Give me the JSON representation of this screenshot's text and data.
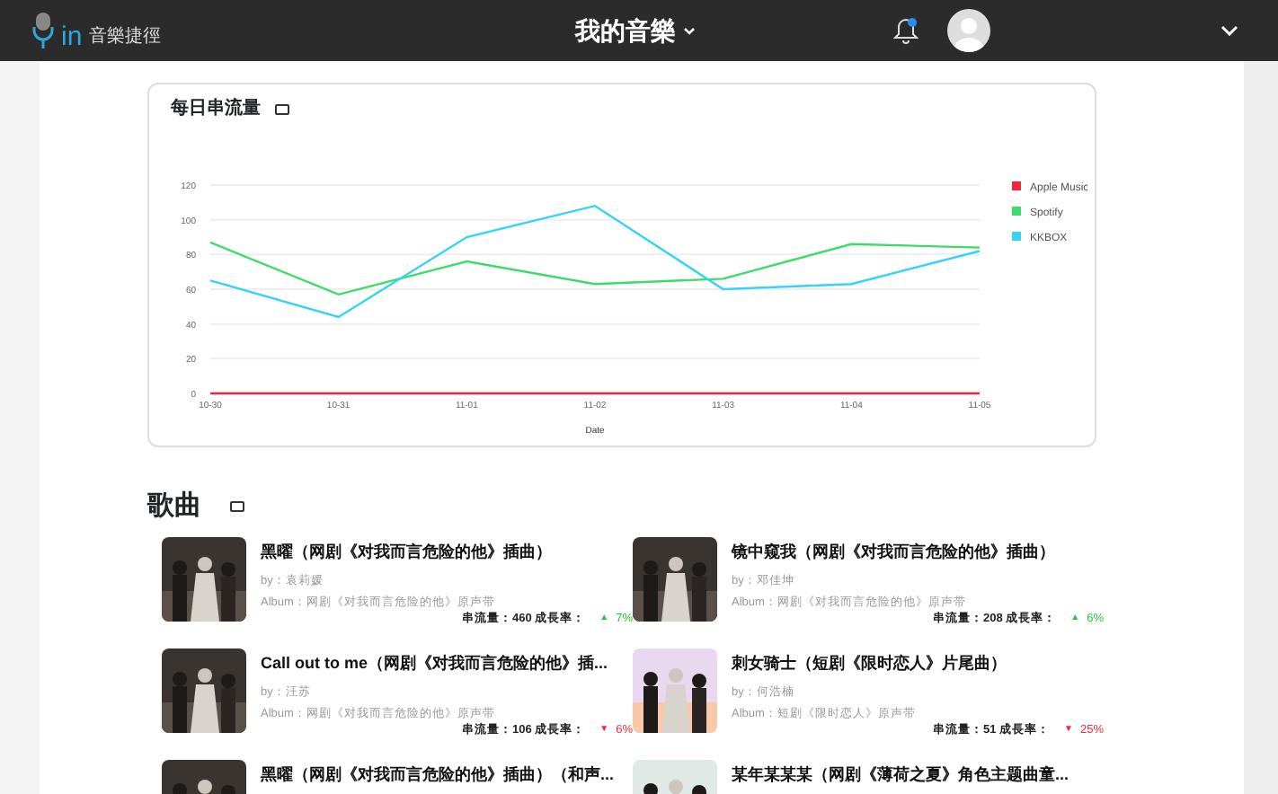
{
  "header": {
    "logo_text": "in",
    "brand": "音樂捷徑",
    "title": "我的音樂",
    "notification_dot": true
  },
  "chart_card": {
    "title": "每日串流量",
    "chart_data": {
      "type": "line",
      "xlabel": "Date",
      "categories": [
        "10-30",
        "10-31",
        "11-01",
        "11-02",
        "11-03",
        "11-04",
        "11-05"
      ],
      "ylim": [
        0,
        120
      ],
      "yticks": [
        0,
        20,
        40,
        60,
        80,
        100,
        120
      ],
      "grid": true,
      "legend": true,
      "series": [
        {
          "name": "Apple Music",
          "color": "#f0283c",
          "values": [
            0,
            0,
            0,
            0,
            0,
            0,
            0
          ]
        },
        {
          "name": "Spotify",
          "color": "#3ddc6a",
          "values": [
            87,
            57,
            76,
            63,
            66,
            86,
            84
          ]
        },
        {
          "name": "KKBOX",
          "color": "#35d3f5",
          "values": [
            65,
            44,
            90,
            108,
            60,
            63,
            82
          ]
        }
      ]
    }
  },
  "songs": {
    "title": "歌曲",
    "items": [
      {
        "title": "黑曜（网剧《对我而言危险的他》插曲）",
        "artist": "by：袁莉媛",
        "album": "Album：网剧《对我而言危险的他》原声带",
        "stats": "串流量：460 成長率：",
        "arrow": "▲",
        "growth": "7%",
        "color": "#22c43a"
      },
      {
        "title": "镜中窥我（网剧《对我而言危险的他》插曲）",
        "artist": "by：邓佳坤",
        "album": "Album：网剧《对我而言危险的他》原声带",
        "stats": "串流量：208 成長率：",
        "arrow": "▲",
        "growth": "6%",
        "color": "#22c43a"
      },
      {
        "title": "Call out to me（网剧《对我而言危险的他》插...",
        "artist": "by：汪苏",
        "album": "Album：网剧《对我而言危险的他》原声带",
        "stats": "串流量：106 成長率：",
        "arrow": "▼",
        "growth": "6%",
        "color": "#f0283c"
      },
      {
        "title": "刺女骑士（短剧《限时恋人》片尾曲）",
        "artist": "by：何浩楠",
        "album": "Album：短剧《限时恋人》原声带",
        "stats": "串流量：51 成長率：",
        "arrow": "▼",
        "growth": "25%",
        "color": "#f0283c"
      },
      {
        "title": "黑曜（网剧《对我而言危险的他》插曲）（和声..."
      },
      {
        "title": "某年某某某（网剧《薄荷之夏》角色主题曲童..."
      }
    ]
  }
}
